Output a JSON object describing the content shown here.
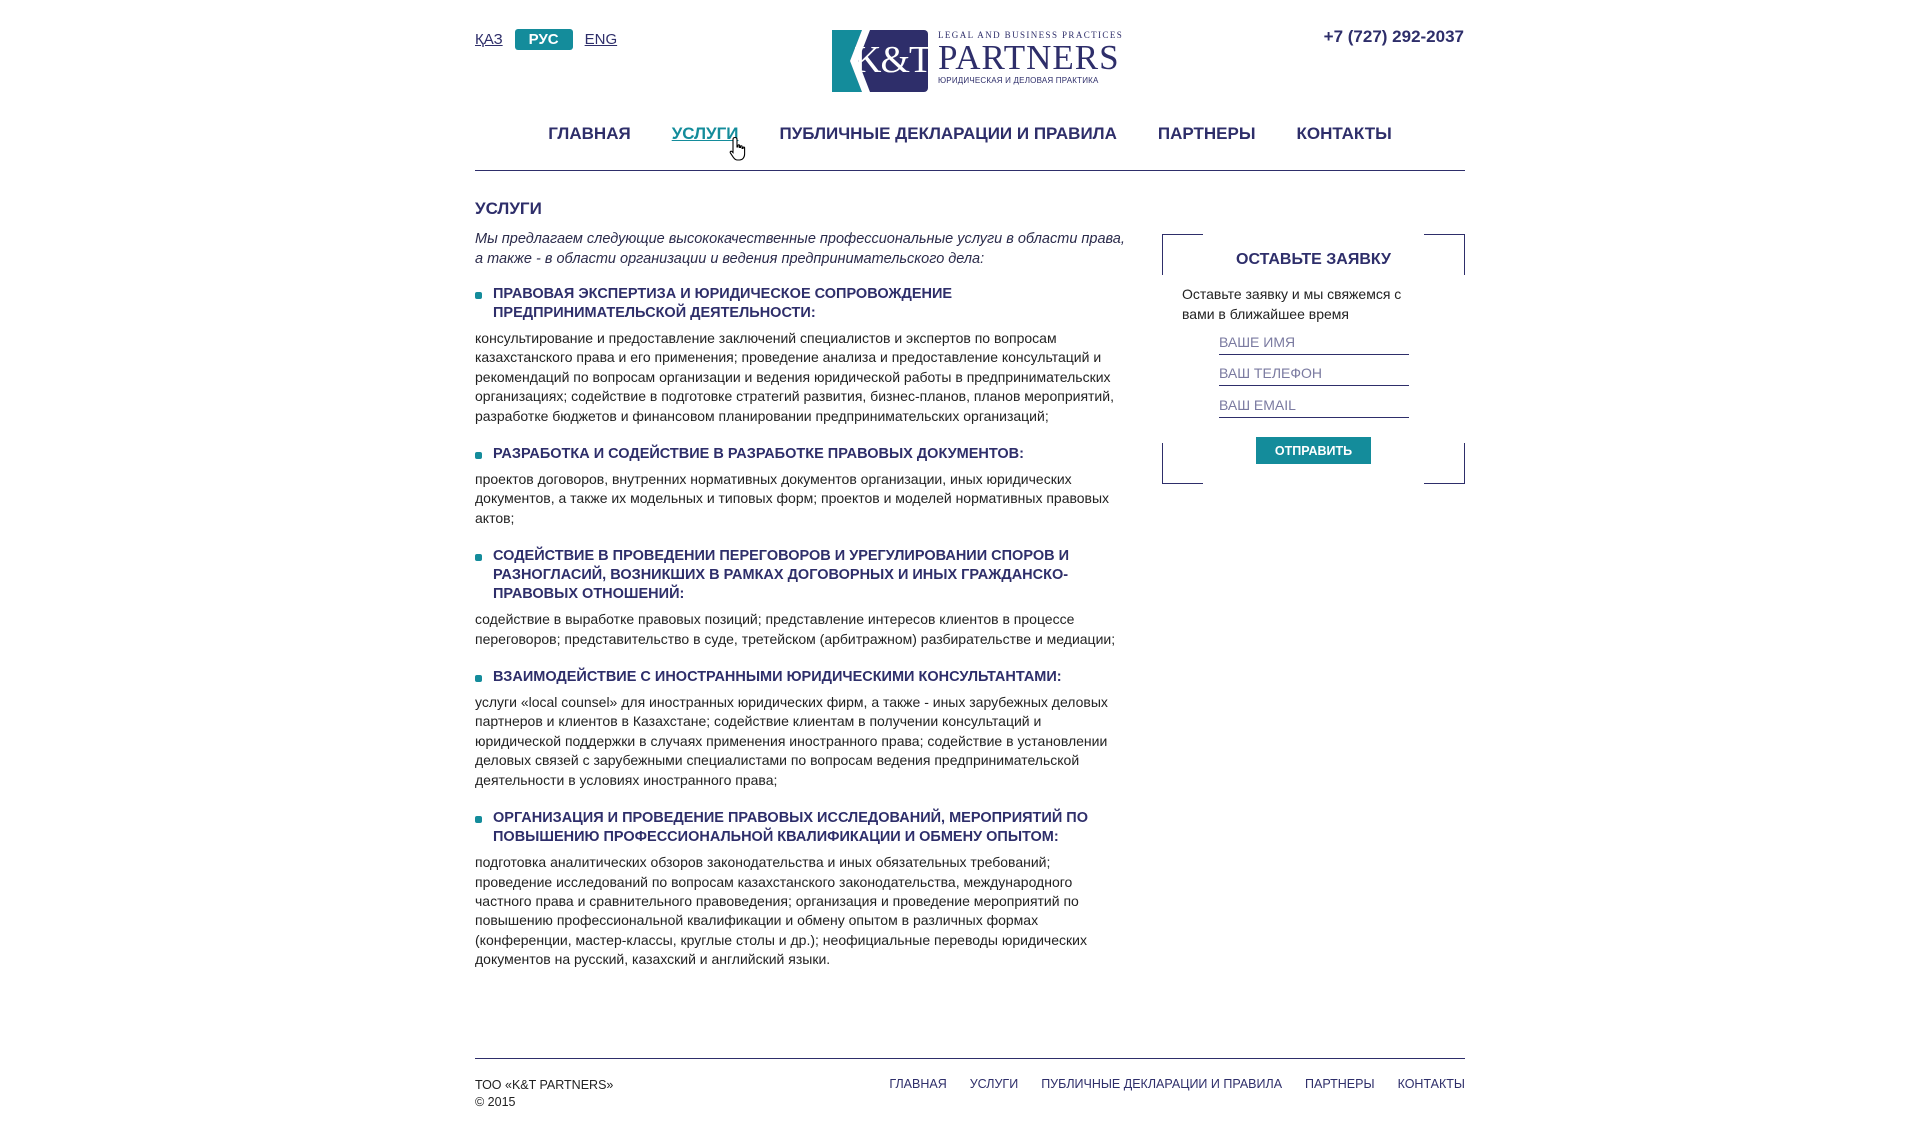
{
  "header": {
    "languages": [
      {
        "label": "ҚАЗ",
        "active": false
      },
      {
        "label": "РУС",
        "active": true
      },
      {
        "label": "ENG",
        "active": false
      }
    ],
    "phone": "+7 (727) 292-2037",
    "logo": {
      "mark": "K&T",
      "top": "LEGAL AND BUSINESS PRACTICES",
      "main": "PARTNERS",
      "bottom": "ЮРИДИЧЕСКАЯ И ДЕЛОВАЯ ПРАКТИКА"
    }
  },
  "nav": {
    "items": [
      {
        "label": "ГЛАВНАЯ"
      },
      {
        "label": "УСЛУГИ",
        "current": true
      },
      {
        "label": "ПУБЛИЧНЫЕ ДЕКЛАРАЦИИ И ПРАВИЛА"
      },
      {
        "label": "ПАРТНЕРЫ"
      },
      {
        "label": "КОНТАКТЫ"
      }
    ]
  },
  "main": {
    "title": "УСЛУГИ",
    "intro": "Мы предлагаем следующие высококачественные профессиональные услуги в области права, а также - в области организации и ведения предпринимательского дела:",
    "services": [
      {
        "heading": "ПРАВОВАЯ ЭКСПЕРТИЗА И ЮРИДИЧЕСКОЕ СОПРОВОЖДЕНИЕ ПРЕДПРИНИМАТЕЛЬСКОЙ ДЕЯТЕЛЬНОСТИ:",
        "text": "консультирование и предоставление заключений специалистов и экспертов по вопросам казахстанского права и его применения; проведение анализа и предоставление консультаций и рекомендаций по вопросам организации и ведения юридической работы в предпринимательских организациях; содействие в подготовке стратегий развития, бизнес-планов, планов мероприятий, разработке бюджетов и финансовом планировании предпринимательских организаций;"
      },
      {
        "heading": "РАЗРАБОТКА И СОДЕЙСТВИЕ В РАЗРАБОТКЕ ПРАВОВЫХ ДОКУМЕНТОВ:",
        "text": "проектов договоров, внутренних нормативных документов организации, иных юридических документов, а также их модельных и типовых форм; проектов и моделей нормативных правовых актов;"
      },
      {
        "heading": "СОДЕЙСТВИЕ В ПРОВЕДЕНИИ ПЕРЕГОВОРОВ И УРЕГУЛИРОВАНИИ СПОРОВ И РАЗНОГЛАСИЙ, ВОЗНИКШИХ В РАМКАХ ДОГОВОРНЫХ И ИНЫХ ГРАЖДАНСКО-ПРАВОВЫХ ОТНОШЕНИЙ:",
        "text": "содействие в выработке правовых позиций; представление интересов клиентов в процессе переговоров; представительство в суде, третейском (арбитражном) разбирательстве и медиации;"
      },
      {
        "heading": "ВЗАИМОДЕЙСТВИЕ С ИНОСТРАННЫМИ ЮРИДИЧЕСКИМИ КОНСУЛЬТАНТАМИ:",
        "text": "услуги «local counsel» для иностранных юридических фирм, а также - иных зарубежных деловых партнеров и клиентов в Казахстане; содействие клиентам в получении консультаций и юридической поддержки в случаях применения иностранного права; содействие в установлении деловых связей с зарубежными специалистами по вопросам ведения предпринимательской деятельности в условиях иностранного права;"
      },
      {
        "heading": "ОРГАНИЗАЦИЯ И ПРОВЕДЕНИЕ ПРАВОВЫХ ИССЛЕДОВАНИЙ, МЕРОПРИЯТИЙ ПО ПОВЫШЕНИЮ ПРОФЕССИОНАЛЬНОЙ КВАЛИФИКАЦИИ И ОБМЕНУ ОПЫТОМ:",
        "text": "подготовка аналитических обзоров законодательства и иных обязательных требований; проведение исследований по вопросам казахстанского законодательства, международного частного права и сравнительного правоведения; организация и проведение мероприятий по повышению профессиональной квалификации и обмену опытом в различных формах (конференции, мастер-классы, круглые столы и др.); неофициальные переводы юридических документов на русский, казахский и английский языки."
      }
    ]
  },
  "form": {
    "title": "ОСТАВЬТЕ ЗАЯВКУ",
    "description": "Оставьте заявку и мы свяжемся с вами в ближайшее время",
    "name_placeholder": "ВАШЕ ИМЯ",
    "phone_placeholder": "ВАШ ТЕЛЕФОН",
    "email_placeholder": "ВАШ EMAIL",
    "submit_label": "ОТПРАВИТЬ"
  },
  "footer": {
    "company": "ТОО «K&T PARTNERS»",
    "copyright": "© 2015",
    "nav": [
      {
        "label": "ГЛАВНАЯ"
      },
      {
        "label": "УСЛУГИ"
      },
      {
        "label": "ПУБЛИЧНЫЕ ДЕКЛАРАЦИИ И ПРАВИЛА"
      },
      {
        "label": "ПАРТНЕРЫ"
      },
      {
        "label": "КОНТАКТЫ"
      }
    ]
  },
  "colors": {
    "brand": "#2e2e6a",
    "accent": "#148c9b"
  },
  "icons": {
    "cursor": "hand-pointer-icon"
  }
}
